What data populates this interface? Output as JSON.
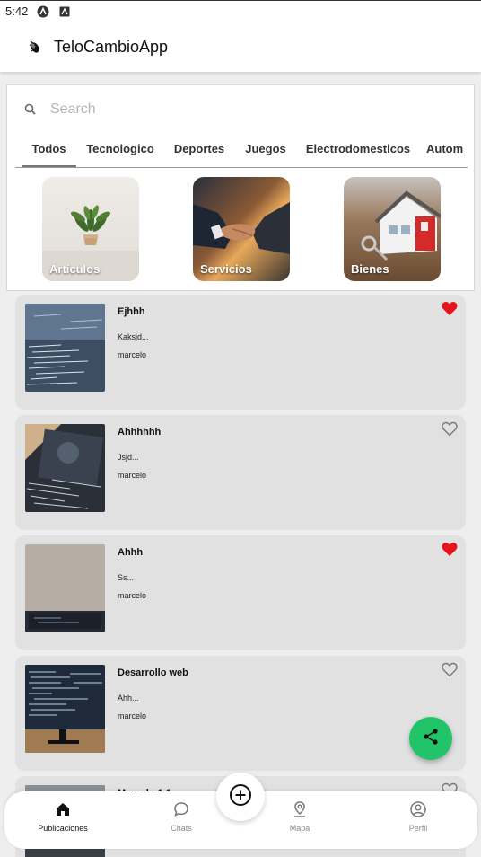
{
  "status_bar": {
    "time": "5:42"
  },
  "app_bar": {
    "title": "TeloCambioApp"
  },
  "search": {
    "placeholder": "Search",
    "value": ""
  },
  "tabs": [
    {
      "label": "Todos",
      "active": true
    },
    {
      "label": "Tecnologico",
      "active": false
    },
    {
      "label": "Deportes",
      "active": false
    },
    {
      "label": "Juegos",
      "active": false
    },
    {
      "label": "Electrodomesticos",
      "active": false
    },
    {
      "label": "Autom",
      "active": false
    }
  ],
  "categories": [
    {
      "label": "Artículos",
      "image": "plant-photo"
    },
    {
      "label": "Servicios",
      "image": "handshake-photo"
    },
    {
      "label": "Bienes",
      "image": "house-keys-photo"
    }
  ],
  "publications": [
    {
      "title": "Ejhhh",
      "description": "Kaksjd...",
      "user": "marcelo",
      "favorite": true,
      "image": "code-screen-photo"
    },
    {
      "title": "Ahhhhhh",
      "description": "Jsjd...",
      "user": "marcelo",
      "favorite": false,
      "image": "laptop-photo"
    },
    {
      "title": "Ahhh",
      "description": "Ss...",
      "user": "marcelo",
      "favorite": true,
      "image": "wall-laptop-photo"
    },
    {
      "title": "Desarrollo web",
      "description": "Ahh...",
      "user": "marcelo",
      "favorite": false,
      "image": "monitor-code-photo"
    },
    {
      "title": "Marcelo 1.1",
      "description": "",
      "user": "",
      "favorite": false,
      "image": "partial-photo"
    }
  ],
  "bottom_nav": [
    {
      "label": "Publicaciones",
      "icon": "home-icon",
      "active": true
    },
    {
      "label": "Chats",
      "icon": "chat-icon",
      "active": false
    },
    {
      "label": "Mapa",
      "icon": "map-pin-icon",
      "active": false
    },
    {
      "label": "Perfil",
      "icon": "profile-icon",
      "active": false
    }
  ],
  "colors": {
    "favorite": "#e8141a",
    "share_fab": "#22c46a",
    "card_bg": "#e1e1e1"
  }
}
